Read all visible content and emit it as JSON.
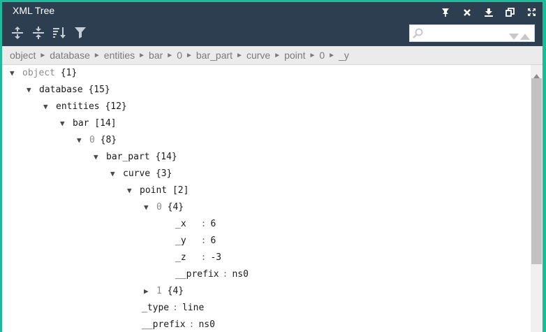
{
  "window": {
    "title": "XML Tree"
  },
  "window_icons": [
    "pin-icon",
    "close-icon",
    "download-icon",
    "copy-icon",
    "expand-icon"
  ],
  "toolbar_icons": [
    "expand-all-icon",
    "collapse-all-icon",
    "sort-icon",
    "filter-icon"
  ],
  "search": {
    "value": "",
    "placeholder": ""
  },
  "breadcrumb": [
    "object",
    "database",
    "entities",
    "bar",
    "0",
    "bar_part",
    "curve",
    "point",
    "0",
    "_y"
  ],
  "colors": {
    "accent": "#1abc9c",
    "header": "#2c3e50",
    "breadcrumb_bg": "#ebebeb"
  },
  "tree": {
    "object_key": "object",
    "object_count": "{1}",
    "database_key": "database",
    "database_count": "{15}",
    "entities_key": "entities",
    "entities_count": "{12}",
    "bar_key": "bar",
    "bar_count": "[14]",
    "bar0_key": "0",
    "bar0_count": "{8}",
    "bar_part_key": "bar_part",
    "bar_part_count": "{14}",
    "curve_key": "curve",
    "curve_count": "{3}",
    "point_key": "point",
    "point_count": "[2]",
    "point0_key": "0",
    "point0_count": "{4}",
    "x_key": "_x",
    "x_value": "6",
    "y_key": "_y",
    "y_value": "6",
    "z_key": "_z",
    "z_value": "-3",
    "prefix_key": "__prefix",
    "prefix_value": "ns0",
    "point1_key": "1",
    "point1_count": "{4}",
    "type_key": "_type",
    "type_value": "line",
    "curve_prefix_key": "__prefix",
    "curve_prefix_value": "ns0"
  }
}
